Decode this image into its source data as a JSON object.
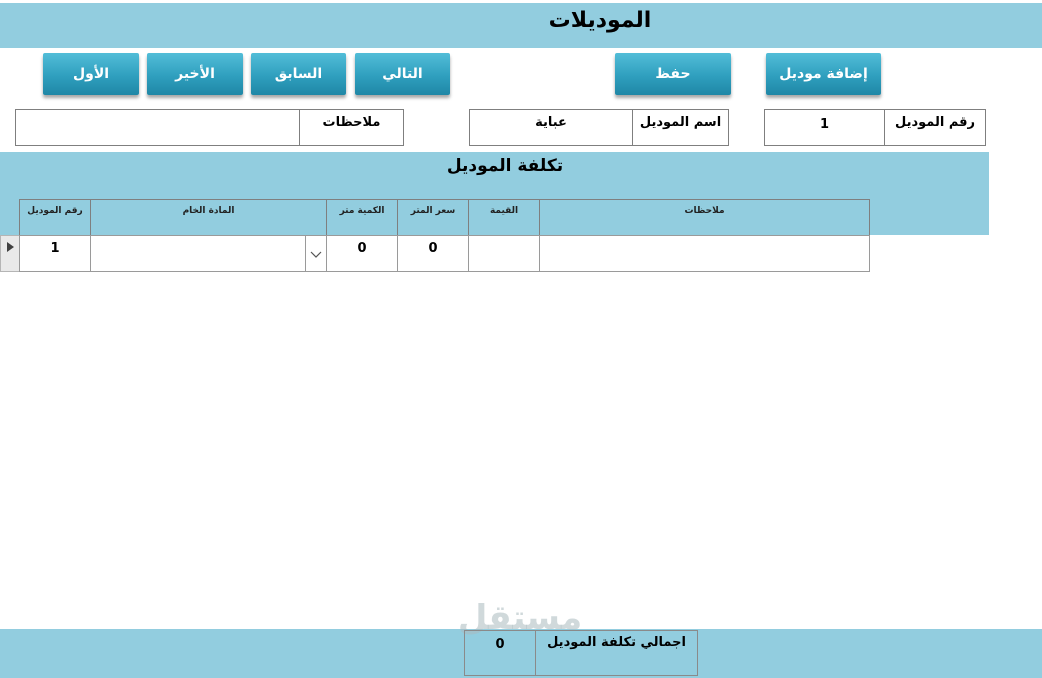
{
  "form": {
    "title": "الموديلات"
  },
  "toolbar": {
    "add_model": "إضافة موديل",
    "save": "حفظ",
    "next": "التالي",
    "previous": "السابق",
    "last": "الأخير",
    "first": "الأول"
  },
  "fields": {
    "model_number_label": "رقم الموديل",
    "model_number_value": "1",
    "model_name_label": "اسم الموديل",
    "model_name_value": "عباية",
    "notes_label": "ملاحظات",
    "notes_value": ""
  },
  "cost_section": {
    "title": "تكلفة الموديل",
    "columns": [
      "رقم الموديل",
      "المادة الخام",
      "الكمية متر",
      "سعر المتر",
      "القيمة",
      "ملاحظات"
    ],
    "rows": [
      {
        "model_number": "1",
        "raw_material": "",
        "quantity_meter": "0",
        "price_per_meter": "0",
        "value": "",
        "notes": ""
      }
    ]
  },
  "footer": {
    "total_label": "اجمالي تكلفة الموديل",
    "total_value": "0",
    "watermark": "مستقل"
  },
  "colors": {
    "band": "#92cddf",
    "button": "#2f9fbe"
  }
}
